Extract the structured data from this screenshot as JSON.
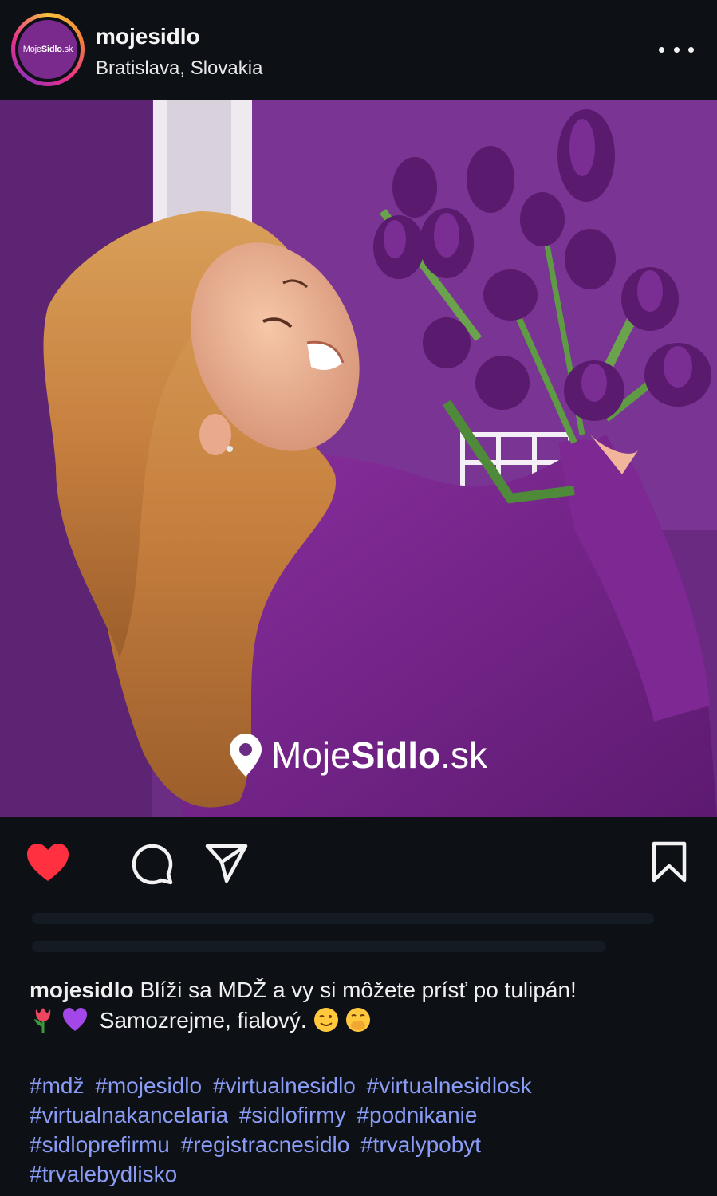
{
  "header": {
    "username": "mojesidlo",
    "location": "Bratislava, Slovakia",
    "avatar_text_light": "Moje",
    "avatar_text_bold": "Sidlo",
    "avatar_text_tail": ".sk"
  },
  "post": {
    "watermark_light": "Moje",
    "watermark_bold": "Sidlo",
    "watermark_tail": ".sk",
    "liked": true
  },
  "actions": {
    "like_icon": "heart-filled-icon",
    "comment_icon": "comment-icon",
    "share_icon": "send-icon",
    "save_icon": "bookmark-icon"
  },
  "caption": {
    "username": "mojesidlo",
    "line1": "Blíži sa MDŽ a vy si môžete prísť po tulipán!",
    "line2": "Samozrejme, fialový."
  },
  "hashtags": [
    "#mdž",
    "#mojesidlo",
    "#virtualnesidlo",
    "#virtualnesidlosk",
    "#virtualnakancelaria",
    "#sidlofirmy",
    "#podnikanie",
    "#sidloprefirmu",
    "#registracnesidlo",
    "#trvalypobyt",
    "#trvalebydlisko"
  ],
  "colors": {
    "background": "#0d1116",
    "like_red": "#ff3040",
    "hashtag_blue": "#8a9cf5",
    "brand_purple": "#7a2a8c"
  }
}
